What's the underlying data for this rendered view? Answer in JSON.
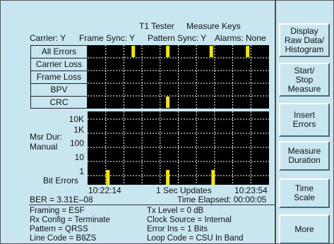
{
  "header": {
    "title": "T1 Tester",
    "subtitle": "Measure Keys"
  },
  "status": {
    "carrier": "Carrier: Y",
    "frame_sync": "Frame Sync: Y",
    "pattern_sync": "Pattern Sync: Y",
    "alarms": "Alarms: None"
  },
  "alarm_rows": [
    {
      "label": "All Errors",
      "events": [
        0.25,
        0.44,
        0.68,
        0.88
      ]
    },
    {
      "label": "Carrier Loss",
      "events": []
    },
    {
      "label": "Frame Loss",
      "events": []
    },
    {
      "label": "BPV",
      "events": []
    },
    {
      "label": "CRC",
      "events": [
        0.44
      ]
    }
  ],
  "error_graph": {
    "measure_duration_label": "Msr Dur:",
    "measure_duration_value": "Manual",
    "y_ticks": [
      "10K",
      "1K",
      "100",
      "10",
      "1"
    ],
    "y_label": "Bit Errors",
    "bars": [
      {
        "t": 0.11,
        "level": 1
      },
      {
        "t": 0.44,
        "level": 1
      },
      {
        "t": 0.69,
        "level": 1
      }
    ],
    "start_time": "10:22:14",
    "update_rate": "1 Sec Updates",
    "end_time": "10:23:54"
  },
  "measurements": {
    "ber": "BER = 3.31E–08",
    "time_elapsed": "Time Elapsed: 00:00:05"
  },
  "config": {
    "left": [
      "Framing = ESF",
      "Rx Config = Terminate",
      "Pattern = QRSS",
      "Line Code = B8ZS"
    ],
    "right": [
      "Tx Level = 0 dB",
      "Clock Source = Internal",
      "Error Ins = 1 Bits",
      "Loop Code = CSU In Band"
    ]
  },
  "softkeys": [
    "Display\nRaw Data/\nHistogram",
    "Start/\nStop\nMeasure",
    "Insert\nErrors",
    "Measure\nDuration",
    "Time\nScale",
    "More"
  ],
  "colors": {
    "screen_bg": "#c8e6f0",
    "grid_bg": "#000000",
    "grid_line": "#ffffff",
    "event_marker": "#f5e600"
  }
}
